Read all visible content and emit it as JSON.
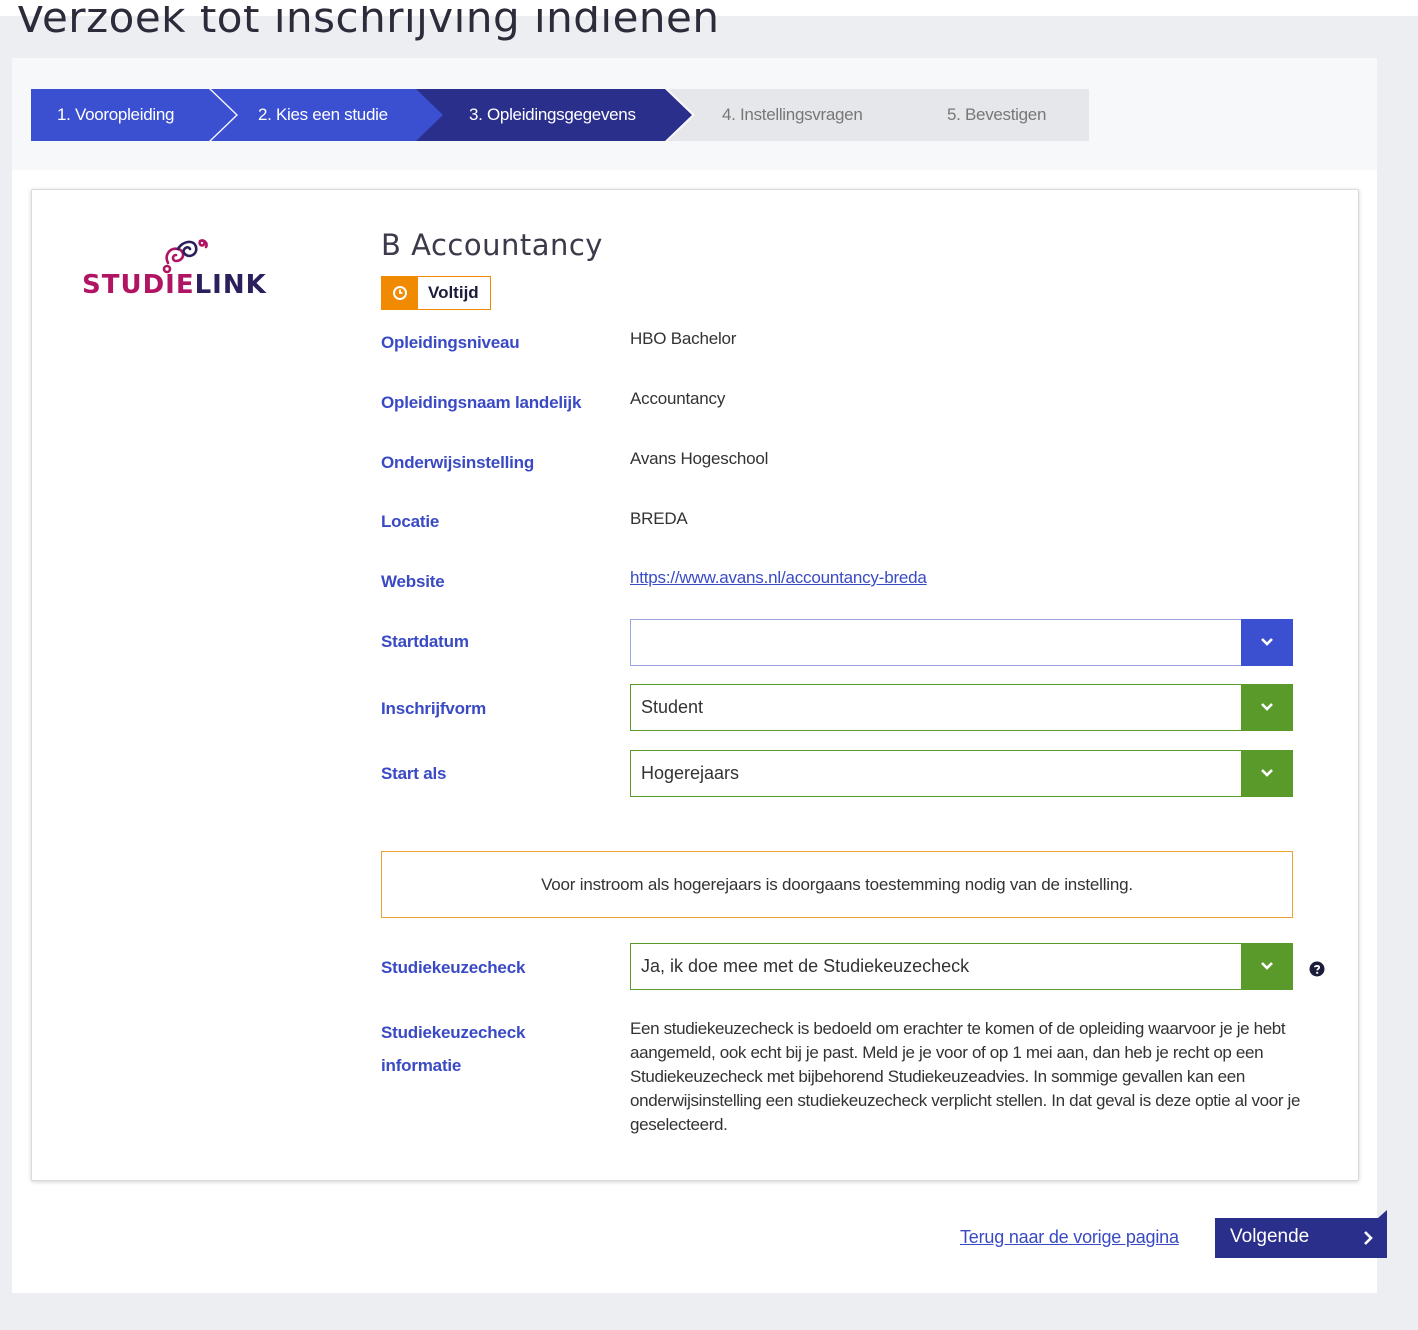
{
  "page": {
    "title": "Verzoek tot inschrijving indienen"
  },
  "steps": [
    {
      "label": "1. Vooropleiding",
      "state": "done"
    },
    {
      "label": "2. Kies een studie",
      "state": "done"
    },
    {
      "label": "3. Opleidingsgegevens",
      "state": "active"
    },
    {
      "label": "4. Instellingsvragen",
      "state": "todo"
    },
    {
      "label": "5. Bevestigen",
      "state": "todo"
    }
  ],
  "logo": {
    "part1": "STUDIE",
    "part2": "LINK"
  },
  "programme": {
    "title": "B Accountancy",
    "badge": "Voltijd"
  },
  "fields": {
    "level": {
      "label": "Opleidingsniveau",
      "value": "HBO Bachelor"
    },
    "national_name": {
      "label": "Opleidingsnaam landelijk",
      "value": "Accountancy"
    },
    "institution": {
      "label": "Onderwijsinstelling",
      "value": "Avans Hogeschool"
    },
    "location": {
      "label": "Locatie",
      "value": "BREDA"
    },
    "website": {
      "label": "Website",
      "value": "https://www.avans.nl/accountancy-breda"
    },
    "start_date": {
      "label": "Startdatum",
      "value": ""
    },
    "enrol_form": {
      "label": "Inschrijfvorm",
      "value": "Student"
    },
    "start_as": {
      "label": "Start als",
      "value": "Hogerejaars"
    },
    "check": {
      "label": "Studiekeuzecheck",
      "value": "Ja, ik doe mee met de Studiekeuzecheck"
    },
    "check_info": {
      "label_line1": "Studiekeuzecheck",
      "label_line2": "informatie",
      "value": "Een studiekeuzecheck is bedoeld om erachter te komen of de opleiding waarvoor je je hebt aangemeld, ook echt bij je past. Meld je je voor of op 1 mei aan, dan heb je recht op een Studiekeuzecheck met bijbehorend Studiekeuzeadvies. In sommige gevallen kan een onderwijsinstelling een studiekeuzecheck verplicht stellen. In dat geval is deze optie al voor je geselecteerd."
    }
  },
  "notice": "Voor instroom als hogerejaars is doorgaans toestemming nodig van de instelling.",
  "footer": {
    "back_label": "Terug naar de vorige pagina",
    "next_label": "Volgende"
  },
  "colors": {
    "step_done": "#3b4fd1",
    "step_active": "#2b2f8c",
    "step_todo": "#e6e7ea",
    "label_blue": "#3a4ac4",
    "select_green": "#5a9a2a",
    "badge_orange": "#f08a00",
    "brand_pink": "#b01563",
    "brand_dark": "#2b1f5c"
  }
}
